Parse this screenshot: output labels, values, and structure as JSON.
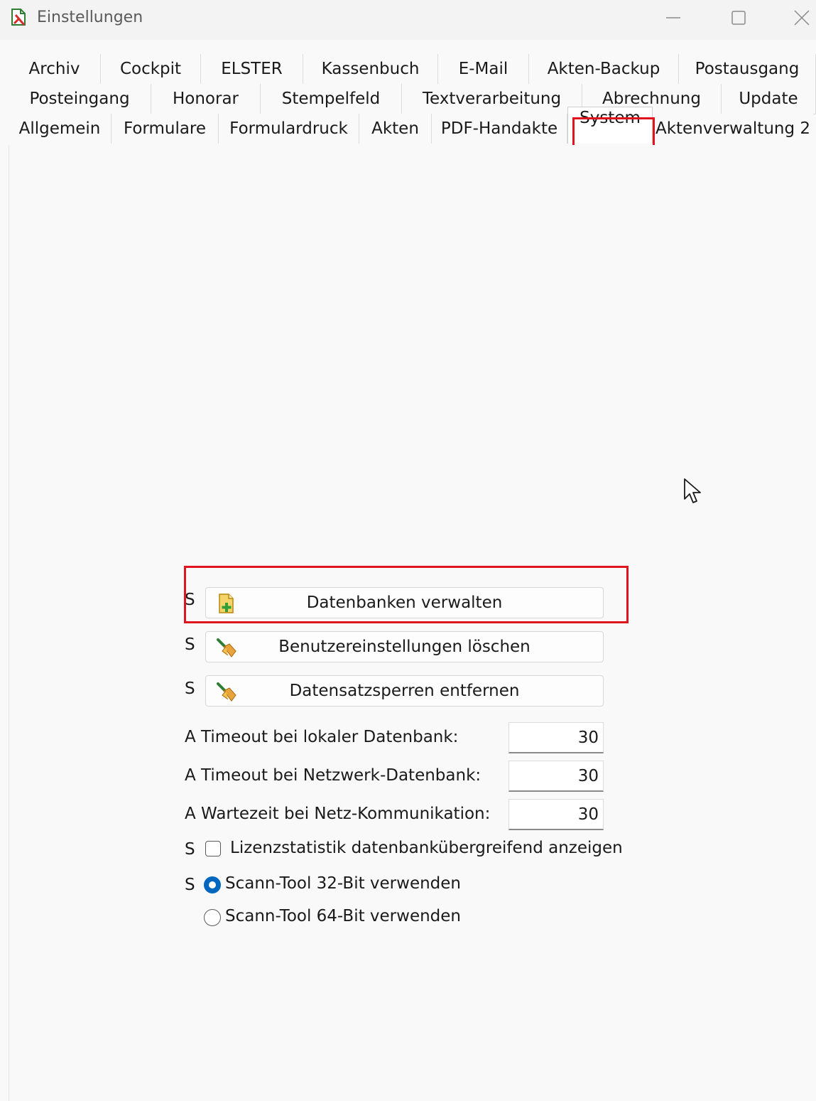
{
  "window": {
    "title": "Einstellungen",
    "icon": "app-document-icon"
  },
  "tabs": {
    "row1": [
      "Archiv",
      "Cockpit",
      "ELSTER",
      "Kassenbuch",
      "E-Mail",
      "Akten-Backup",
      "Postausgang"
    ],
    "row2": [
      "Posteingang",
      "Honorar",
      "Stempelfeld",
      "Textverarbeitung",
      "Abrechnung",
      "Update"
    ],
    "row3": [
      "Allgemein",
      "Formulare",
      "Formulardruck",
      "Akten",
      "PDF-Handakte",
      "System",
      "Aktenverwaltung 2"
    ],
    "active": "System"
  },
  "system": {
    "buttons": [
      {
        "prefix": "S",
        "label": "Datenbanken verwalten",
        "icon": "database-add-icon"
      },
      {
        "prefix": "S",
        "label": "Benutzereinstellungen löschen",
        "icon": "broom-icon"
      },
      {
        "prefix": "S",
        "label": "Datensatzsperren entfernen",
        "icon": "broom-icon"
      }
    ],
    "fields": [
      {
        "label": "A Timeout bei lokaler Datenbank:",
        "value": "30"
      },
      {
        "label": "A Timeout bei Netzwerk-Datenbank:",
        "value": "30"
      },
      {
        "label": "A Wartezeit bei Netz-Kommunikation:",
        "value": "30"
      }
    ],
    "checkbox": {
      "prefix": "S",
      "label": "Lizenzstatistik datenbankübergreifend anzeigen",
      "checked": false
    },
    "radio_prefix": "S",
    "radios": [
      {
        "label": "Scann-Tool 32-Bit verwenden",
        "selected": true
      },
      {
        "label": "Scann-Tool 64-Bit verwenden",
        "selected": false
      }
    ]
  },
  "colors": {
    "highlight": "#e0141c",
    "accent": "#0067c0"
  }
}
